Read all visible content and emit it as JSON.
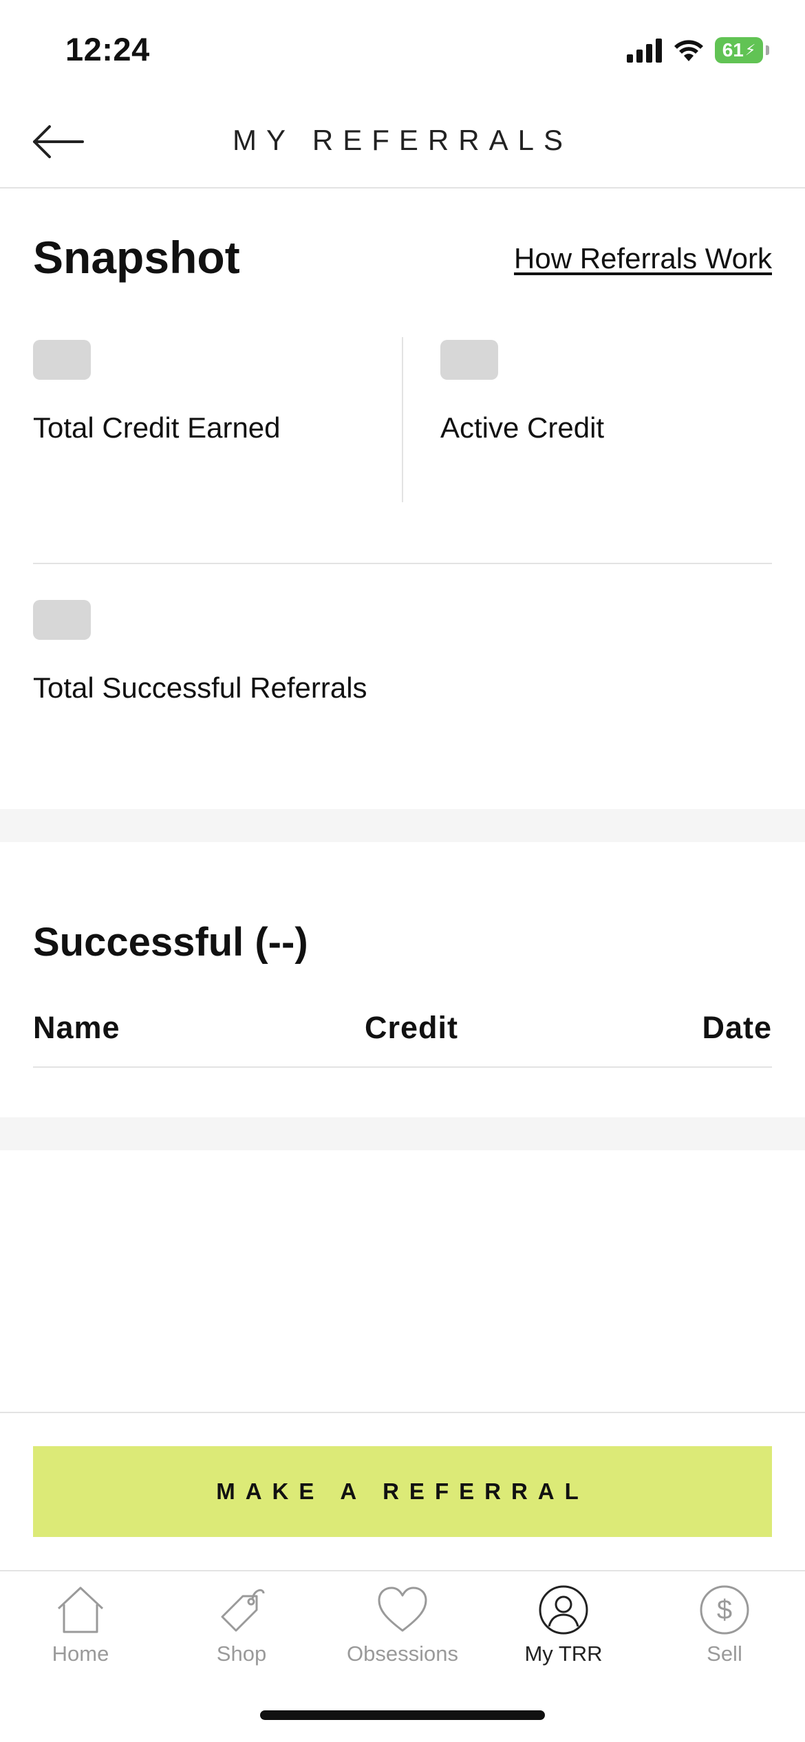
{
  "status_bar": {
    "time": "12:24",
    "battery": "61"
  },
  "header": {
    "title": "MY REFERRALS"
  },
  "snapshot": {
    "title": "Snapshot",
    "how_link": "How Referrals Work",
    "stats": [
      {
        "label": "Total Credit Earned"
      },
      {
        "label": "Active Credit"
      },
      {
        "label": "Total Successful Referrals"
      }
    ]
  },
  "successful": {
    "title": "Successful (--)",
    "columns": [
      "Name",
      "Credit",
      "Date"
    ]
  },
  "cta": {
    "label": "MAKE A REFERRAL"
  },
  "tabbar": {
    "items": [
      {
        "label": "Home",
        "icon": "home-icon"
      },
      {
        "label": "Shop",
        "icon": "tag-icon"
      },
      {
        "label": "Obsessions",
        "icon": "heart-icon"
      },
      {
        "label": "My TRR",
        "icon": "user-icon",
        "active": true
      },
      {
        "label": "Sell",
        "icon": "dollar-icon"
      }
    ]
  },
  "colors": {
    "accent": "#dcea77",
    "placeholder": "#d7d7d7",
    "band": "#f5f5f5",
    "battery": "#61c354"
  }
}
